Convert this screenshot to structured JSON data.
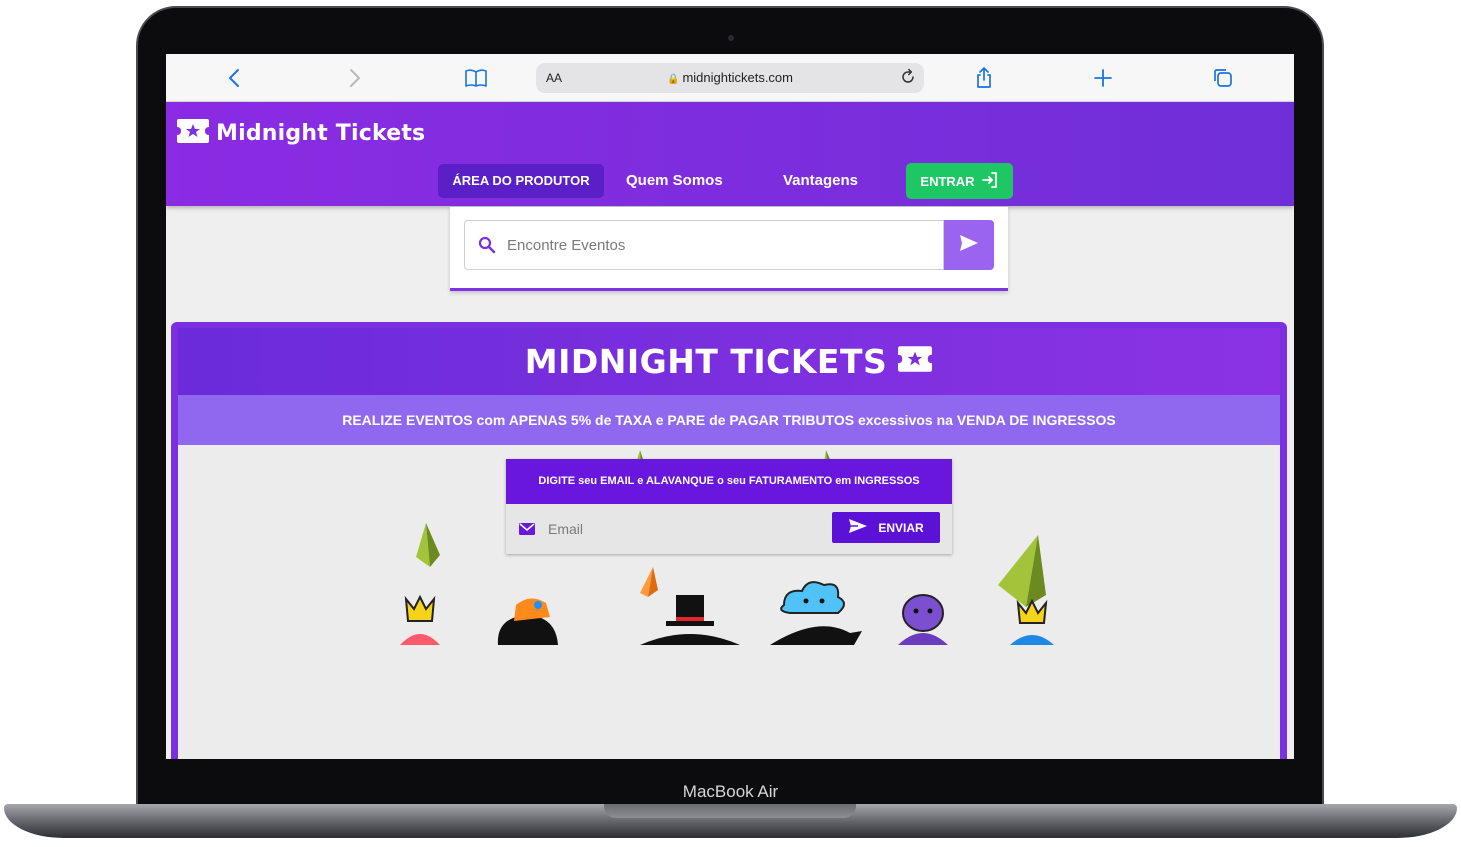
{
  "device": {
    "model_label": "MacBook Air"
  },
  "browser": {
    "text_size_label": "AA",
    "url": "midnightickets.com",
    "icons": [
      "back-icon",
      "forward-icon",
      "bookmarks-icon",
      "lock-icon",
      "reload-icon",
      "share-icon",
      "new-tab-icon",
      "tabs-icon"
    ]
  },
  "site": {
    "logo_text": "Midnight Tickets",
    "nav": {
      "producer_area": "ÁREA DO PRODUTOR",
      "about": "Quem Somos",
      "advantages": "Vantagens",
      "login": "ENTRAR"
    },
    "search": {
      "placeholder": "Encontre Eventos"
    },
    "hero": {
      "title": "MIDNIGHT TICKETS",
      "tagline": "REALIZE EVENTOS com APENAS 5% de TAXA e PARE de PAGAR TRIBUTOS excessivos na VENDA DE INGRESSOS",
      "signup_heading": "DIGITE seu EMAIL e ALAVANQUE o seu FATURAMENTO em INGRESSOS",
      "email_placeholder": "Email",
      "send_label": "ENVIAR"
    }
  },
  "colors": {
    "brand_purple": "#7a30e0",
    "deep_purple": "#5b12d6",
    "band_purple": "#9068ef",
    "login_green": "#1fc664",
    "browser_accent": "#1a73e8"
  }
}
